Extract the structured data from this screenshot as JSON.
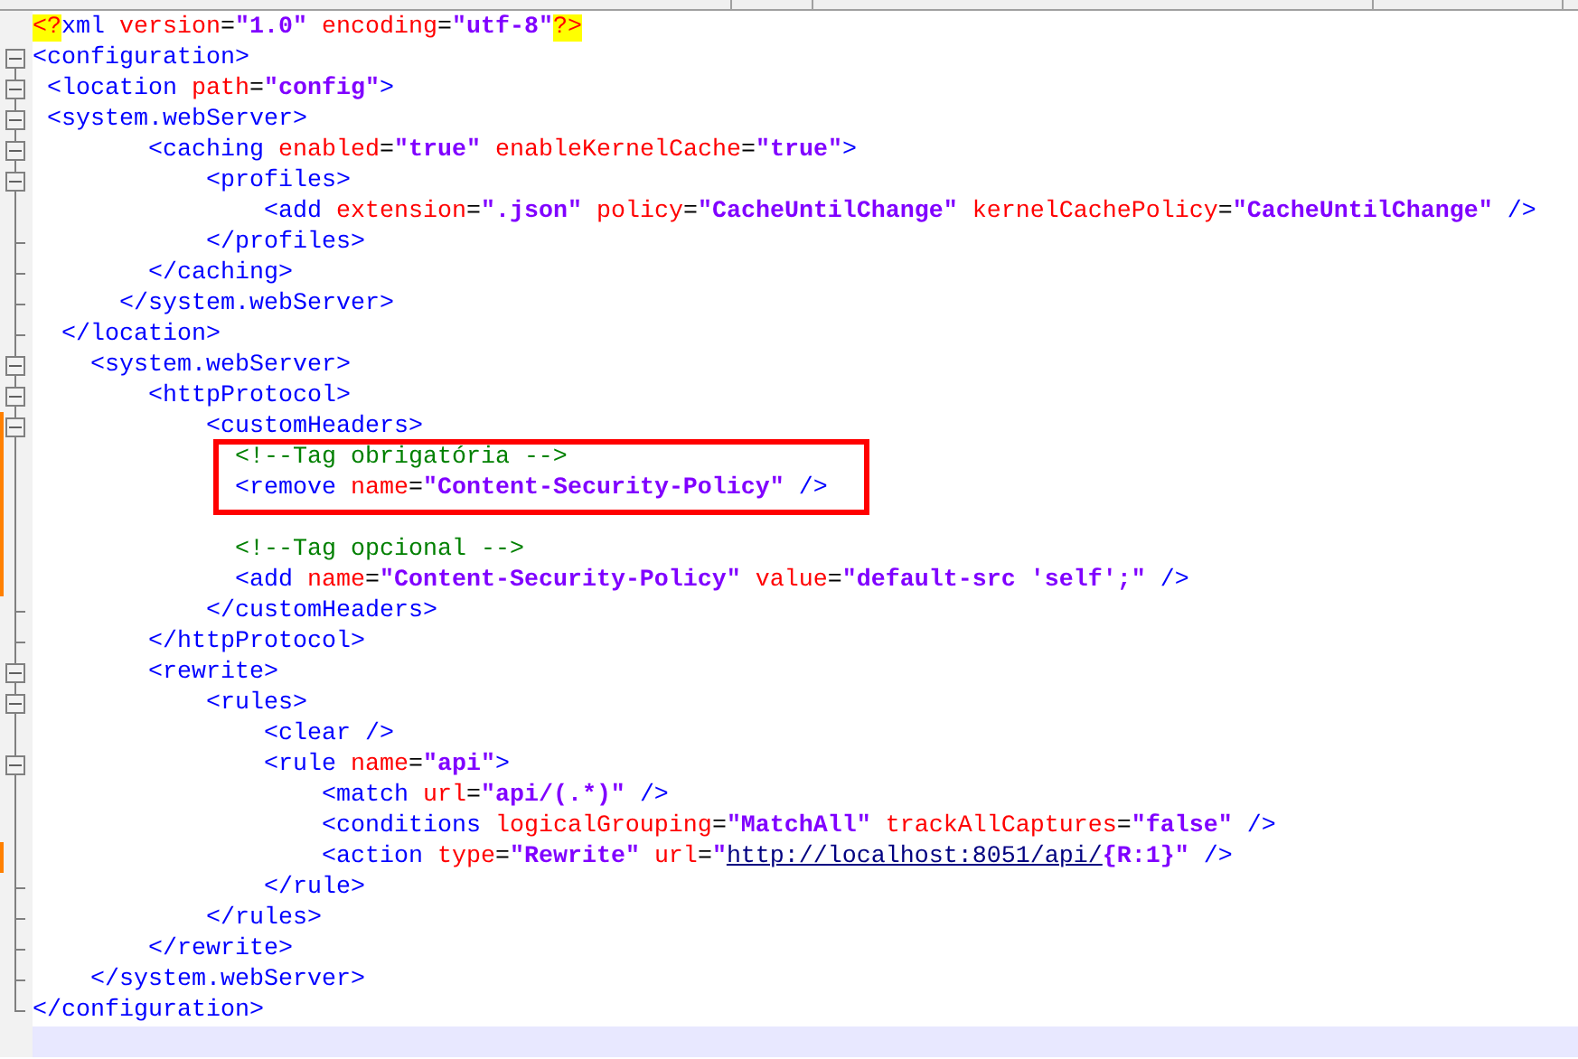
{
  "lines": [
    {
      "kind": "blank",
      "tokens": [
        {
          "kind": "decl",
          "text": "<?"
        },
        {
          "kind": "tag",
          "text": "xml "
        },
        {
          "kind": "attr",
          "text": "version"
        },
        {
          "kind": "eq",
          "text": "="
        },
        {
          "kind": "value",
          "text": "\"1.0\" "
        },
        {
          "kind": "attr",
          "text": "encoding"
        },
        {
          "kind": "eq",
          "text": "="
        },
        {
          "kind": "value",
          "text": "\"utf-8\""
        },
        {
          "kind": "decl",
          "text": "?>"
        }
      ]
    },
    {
      "kind": "box",
      "tokens": [
        {
          "kind": "tag",
          "text": "<configuration>"
        }
      ]
    },
    {
      "kind": "box",
      "tokens": [
        {
          "kind": "tag",
          "text": " <location "
        },
        {
          "kind": "attr",
          "text": "path"
        },
        {
          "kind": "eq",
          "text": "="
        },
        {
          "kind": "value",
          "text": "\"config\""
        },
        {
          "kind": "tag",
          "text": ">"
        }
      ]
    },
    {
      "kind": "box",
      "tokens": [
        {
          "kind": "tag",
          "text": " <system.webServer>"
        }
      ]
    },
    {
      "kind": "box",
      "tokens": [
        {
          "kind": "tag",
          "text": "        <caching "
        },
        {
          "kind": "attr",
          "text": "enabled"
        },
        {
          "kind": "eq",
          "text": "="
        },
        {
          "kind": "value",
          "text": "\"true\" "
        },
        {
          "kind": "attr",
          "text": "enableKernelCache"
        },
        {
          "kind": "eq",
          "text": "="
        },
        {
          "kind": "value",
          "text": "\"true\""
        },
        {
          "kind": "tag",
          "text": ">"
        }
      ]
    },
    {
      "kind": "box",
      "tokens": [
        {
          "kind": "tag",
          "text": "            <profiles>"
        }
      ]
    },
    {
      "kind": "line",
      "tokens": [
        {
          "kind": "tag",
          "text": "                <add "
        },
        {
          "kind": "attr",
          "text": "extension"
        },
        {
          "kind": "eq",
          "text": "="
        },
        {
          "kind": "value",
          "text": "\".json\" "
        },
        {
          "kind": "attr",
          "text": "policy"
        },
        {
          "kind": "eq",
          "text": "="
        },
        {
          "kind": "value",
          "text": "\"CacheUntilChange\" "
        },
        {
          "kind": "attr",
          "text": "kernelCachePolicy"
        },
        {
          "kind": "eq",
          "text": "="
        },
        {
          "kind": "value",
          "text": "\"CacheUntilChange\" "
        },
        {
          "kind": "tag",
          "text": "/>"
        }
      ]
    },
    {
      "kind": "end",
      "tokens": [
        {
          "kind": "tag",
          "text": "            </profiles>"
        }
      ]
    },
    {
      "kind": "end",
      "tokens": [
        {
          "kind": "tag",
          "text": "        </caching>"
        }
      ]
    },
    {
      "kind": "end",
      "tokens": [
        {
          "kind": "tag",
          "text": "      </system.webServer>"
        }
      ]
    },
    {
      "kind": "end",
      "tokens": [
        {
          "kind": "tag",
          "text": "  </location>"
        }
      ]
    },
    {
      "kind": "box",
      "tokens": [
        {
          "kind": "tag",
          "text": "    <system.webServer>"
        }
      ]
    },
    {
      "kind": "box",
      "tokens": [
        {
          "kind": "tag",
          "text": "        <httpProtocol>"
        }
      ]
    },
    {
      "kind": "box",
      "changed": true,
      "tokens": [
        {
          "kind": "tag",
          "text": "            <customHeaders>"
        }
      ]
    },
    {
      "kind": "line",
      "changed": true,
      "boxed": true,
      "tokens": [
        {
          "kind": "comment",
          "text": "              <!--Tag obrigatória -->"
        }
      ]
    },
    {
      "kind": "line",
      "changed": true,
      "boxed": true,
      "tokens": [
        {
          "kind": "tag",
          "text": "              <remove "
        },
        {
          "kind": "attr",
          "text": "name"
        },
        {
          "kind": "eq",
          "text": "="
        },
        {
          "kind": "value",
          "text": "\"Content-Security-Policy\" "
        },
        {
          "kind": "tag",
          "text": "/>"
        }
      ]
    },
    {
      "kind": "line",
      "changed": true
    },
    {
      "kind": "line",
      "changed": true,
      "tokens": [
        {
          "kind": "comment",
          "text": "              <!--Tag opcional -->"
        }
      ]
    },
    {
      "kind": "line",
      "changed": true,
      "tokens": [
        {
          "kind": "tag",
          "text": "              <add "
        },
        {
          "kind": "attr",
          "text": "name"
        },
        {
          "kind": "eq",
          "text": "="
        },
        {
          "kind": "value",
          "text": "\"Content-Security-Policy\" "
        },
        {
          "kind": "attr",
          "text": "value"
        },
        {
          "kind": "eq",
          "text": "="
        },
        {
          "kind": "value",
          "text": "\"default-src 'self';\" "
        },
        {
          "kind": "tag",
          "text": "/>"
        }
      ]
    },
    {
      "kind": "end",
      "tokens": [
        {
          "kind": "tag",
          "text": "            </customHeaders>"
        }
      ]
    },
    {
      "kind": "end",
      "tokens": [
        {
          "kind": "tag",
          "text": "        </httpProtocol>"
        }
      ]
    },
    {
      "kind": "box",
      "tokens": [
        {
          "kind": "tag",
          "text": "        <rewrite>"
        }
      ]
    },
    {
      "kind": "box",
      "tokens": [
        {
          "kind": "tag",
          "text": "            <rules>"
        }
      ]
    },
    {
      "kind": "line",
      "tokens": [
        {
          "kind": "tag",
          "text": "                <clear />"
        }
      ]
    },
    {
      "kind": "box",
      "tokens": [
        {
          "kind": "tag",
          "text": "                <rule "
        },
        {
          "kind": "attr",
          "text": "name"
        },
        {
          "kind": "eq",
          "text": "="
        },
        {
          "kind": "value",
          "text": "\"api\""
        },
        {
          "kind": "tag",
          "text": ">"
        }
      ]
    },
    {
      "kind": "line",
      "tokens": [
        {
          "kind": "tag",
          "text": "                    <match "
        },
        {
          "kind": "attr",
          "text": "url"
        },
        {
          "kind": "eq",
          "text": "="
        },
        {
          "kind": "value",
          "text": "\"api/(.*)\" "
        },
        {
          "kind": "tag",
          "text": "/>"
        }
      ]
    },
    {
      "kind": "line",
      "tokens": [
        {
          "kind": "tag",
          "text": "                    <conditions "
        },
        {
          "kind": "attr",
          "text": "logicalGrouping"
        },
        {
          "kind": "eq",
          "text": "="
        },
        {
          "kind": "value",
          "text": "\"MatchAll\" "
        },
        {
          "kind": "attr",
          "text": "trackAllCaptures"
        },
        {
          "kind": "eq",
          "text": "="
        },
        {
          "kind": "value",
          "text": "\"false\" "
        },
        {
          "kind": "tag",
          "text": "/>"
        }
      ]
    },
    {
      "kind": "line",
      "changed": true,
      "tokens": [
        {
          "kind": "tag",
          "text": "                    <action "
        },
        {
          "kind": "attr",
          "text": "type"
        },
        {
          "kind": "eq",
          "text": "="
        },
        {
          "kind": "value",
          "text": "\"Rewrite\" "
        },
        {
          "kind": "attr",
          "text": "url"
        },
        {
          "kind": "eq",
          "text": "="
        },
        {
          "kind": "value",
          "text": "\""
        },
        {
          "kind": "link",
          "text": "http://localhost:8051/api/"
        },
        {
          "kind": "value",
          "text": "{R:1}\" "
        },
        {
          "kind": "tag",
          "text": "/>"
        }
      ]
    },
    {
      "kind": "end",
      "tokens": [
        {
          "kind": "tag",
          "text": "                </rule>"
        }
      ]
    },
    {
      "kind": "end",
      "tokens": [
        {
          "kind": "tag",
          "text": "            </rules>"
        }
      ]
    },
    {
      "kind": "end",
      "tokens": [
        {
          "kind": "tag",
          "text": "        </rewrite>"
        }
      ]
    },
    {
      "kind": "end",
      "tokens": [
        {
          "kind": "tag",
          "text": "    </system.webServer>"
        }
      ]
    },
    {
      "kind": "corner",
      "tokens": [
        {
          "kind": "tag",
          "text": "</configuration>"
        }
      ]
    },
    {
      "kind": "blank",
      "current": true
    }
  ]
}
